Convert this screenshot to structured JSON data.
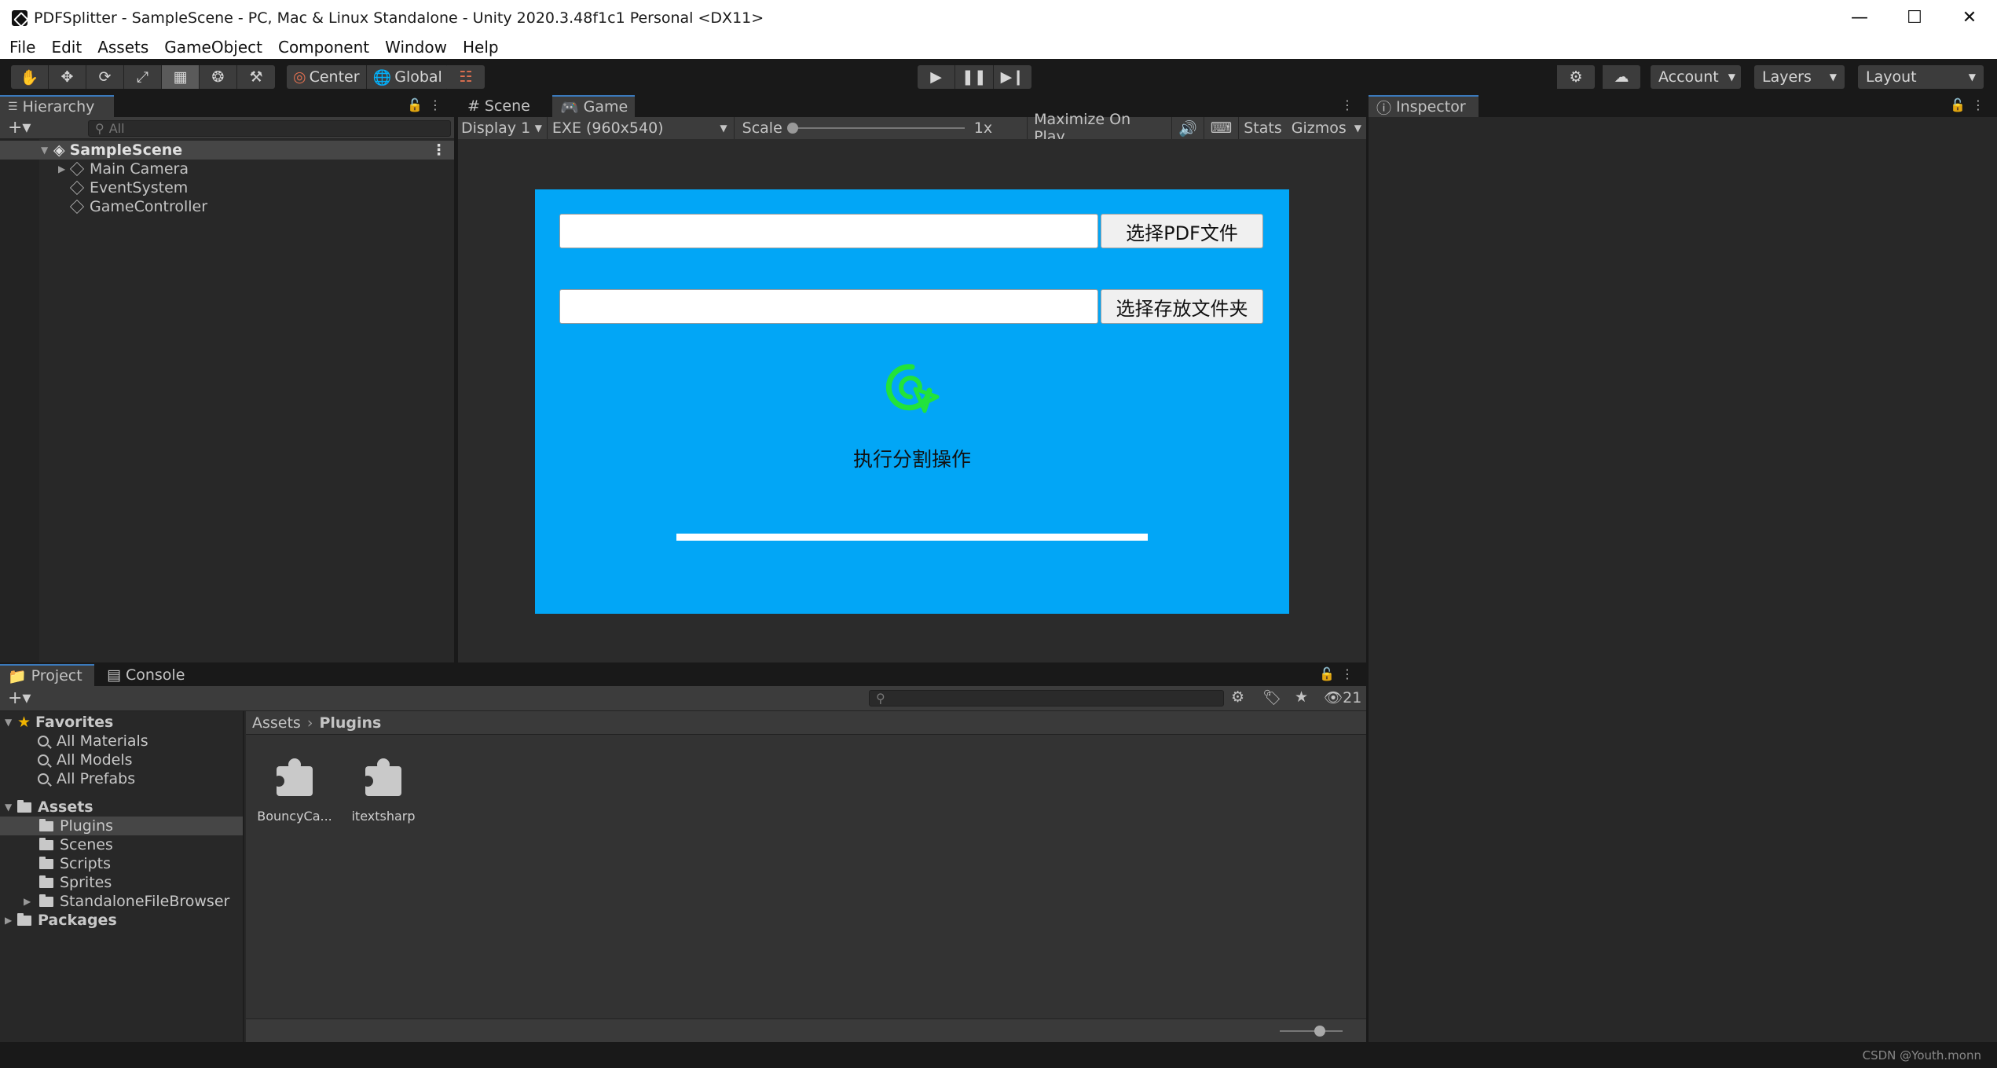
{
  "window": {
    "title": "PDFSplitter - SampleScene - PC, Mac & Linux Standalone - Unity 2020.3.48f1c1 Personal <DX11>"
  },
  "menu": [
    "File",
    "Edit",
    "Assets",
    "GameObject",
    "Component",
    "Window",
    "Help"
  ],
  "toolbar": {
    "pivot": "Center",
    "space": "Global",
    "account": "Account",
    "layers": "Layers",
    "layout": "Layout"
  },
  "hierarchy": {
    "tab": "Hierarchy",
    "search_placeholder": "All",
    "scene": "SampleScene",
    "items": [
      "Main Camera",
      "EventSystem",
      "GameController"
    ]
  },
  "game_view": {
    "tabs": [
      "Scene",
      "Game"
    ],
    "display": "Display 1",
    "resolution": "EXE (960x540)",
    "scale_label": "Scale",
    "scale_value": "1x",
    "maximize": "Maximize On Play",
    "stats": "Stats",
    "gizmos": "Gizmos",
    "ui": {
      "select_pdf_button": "选择PDF文件",
      "select_folder_button": "选择存放文件夹",
      "action_label": "执行分割操作",
      "bg_color": "#02a6f6",
      "icon_color": "#22e33a"
    }
  },
  "inspector": {
    "tab": "Inspector"
  },
  "project": {
    "tabs": [
      "Project",
      "Console"
    ],
    "hidden_count": "21",
    "favorites_label": "Favorites",
    "favorites": [
      "All Materials",
      "All Models",
      "All Prefabs"
    ],
    "assets_label": "Assets",
    "folders": [
      "Plugins",
      "Scenes",
      "Scripts",
      "Sprites",
      "StandaloneFileBrowser"
    ],
    "packages_label": "Packages",
    "breadcrumb": [
      "Assets",
      "Plugins"
    ],
    "files": [
      "BouncyCa...",
      "itextsharp"
    ]
  },
  "status": {
    "watermark": "CSDN @Youth.monn"
  }
}
